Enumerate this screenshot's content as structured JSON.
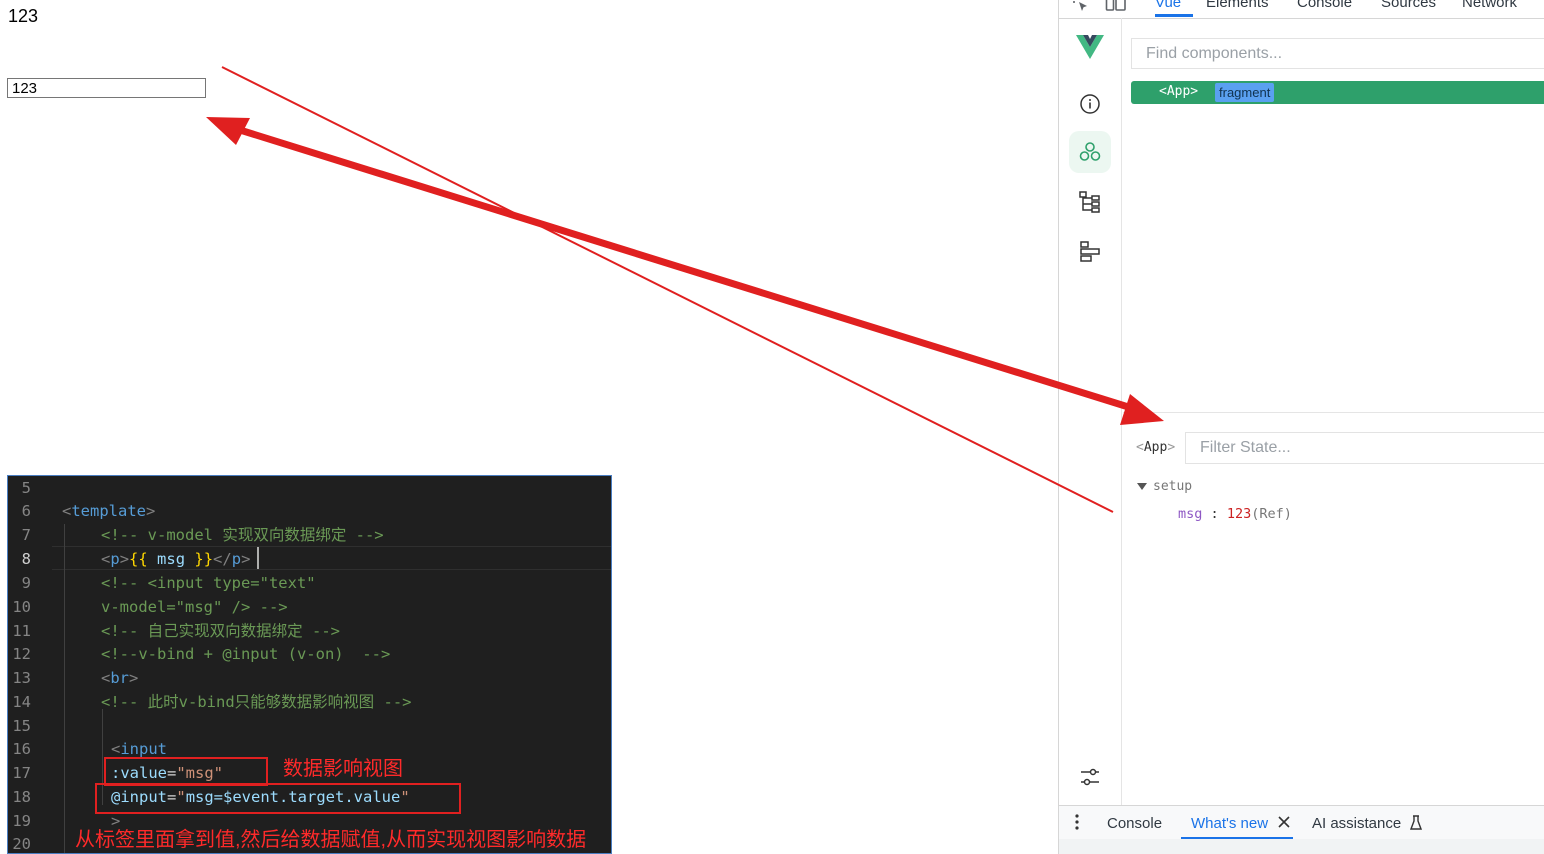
{
  "page": {
    "paragraph": "123",
    "input_value": "123"
  },
  "devtools": {
    "tabs": [
      "Vue",
      "Elements",
      "Console",
      "Sources",
      "Network"
    ],
    "active_tab": "Vue",
    "search_placeholder": "Find components...",
    "tree_row": {
      "name": "<App>",
      "badge": "fragment"
    },
    "state_component": {
      "open": "<",
      "name": "App",
      "close": ">"
    },
    "filter_placeholder": "Filter State...",
    "setup_label": "setup",
    "msg": {
      "key": "msg",
      "colon": ":",
      "value": "123",
      "type": "(Ref)"
    },
    "bottom_tabs": {
      "console": "Console",
      "whats_new": "What's new",
      "ai": "AI assistance"
    },
    "rail_icons": [
      "vue-logo-icon",
      "info-icon",
      "components-icon",
      "tree-icon",
      "timeline-icon",
      "settings-sliders-icon"
    ],
    "accent_color": "#1a73e8",
    "vue_green": "#2ea06b"
  },
  "editor": {
    "line_numbers": [
      "5",
      "6",
      "7",
      "8",
      "9",
      "10",
      "11",
      "12",
      "13",
      "14",
      "15",
      "16",
      "17",
      "18",
      "19",
      "20"
    ],
    "current_line": "8",
    "lines": {
      "l6": {
        "br_open": "<",
        "tag": "template",
        "br_close": ">"
      },
      "l7": "<!-- v-model 实现双向数据绑定 -->",
      "l8": {
        "br1": "<",
        "tag1": "p",
        "br2": ">",
        "m_open": "{{",
        "var": " msg ",
        "m_close": "}}",
        "br3": "</",
        "tag2": "p",
        "br4": ">"
      },
      "l9": "<!-- <input type=\"text\"",
      "l10": "v-model=\"msg\" /> -->",
      "l11": "<!-- 自己实现双向数据绑定 -->",
      "l12": "<!--v-bind + @input (v-on)  -->",
      "l13": {
        "br_open": "<",
        "tag": "br",
        "br_close": ">"
      },
      "l14": "<!-- 此时v-bind只能够数据影响视图 -->",
      "l16": {
        "br_open": "<",
        "tag": "input"
      },
      "l17": {
        "attr": ":value",
        "eq": "=",
        "str": "\"msg\""
      },
      "l18": {
        "attr": "@input",
        "eq": "=",
        "str_open": "\"",
        "str_body": "msg=$event.target.value",
        "str_close": "\""
      },
      "l19": ">"
    }
  },
  "annotations": {
    "note1": "数据影响视图",
    "note2": "从标签里面拿到值,然后给数据赋值,从而实现视图影响数据",
    "color": "#e02020"
  }
}
